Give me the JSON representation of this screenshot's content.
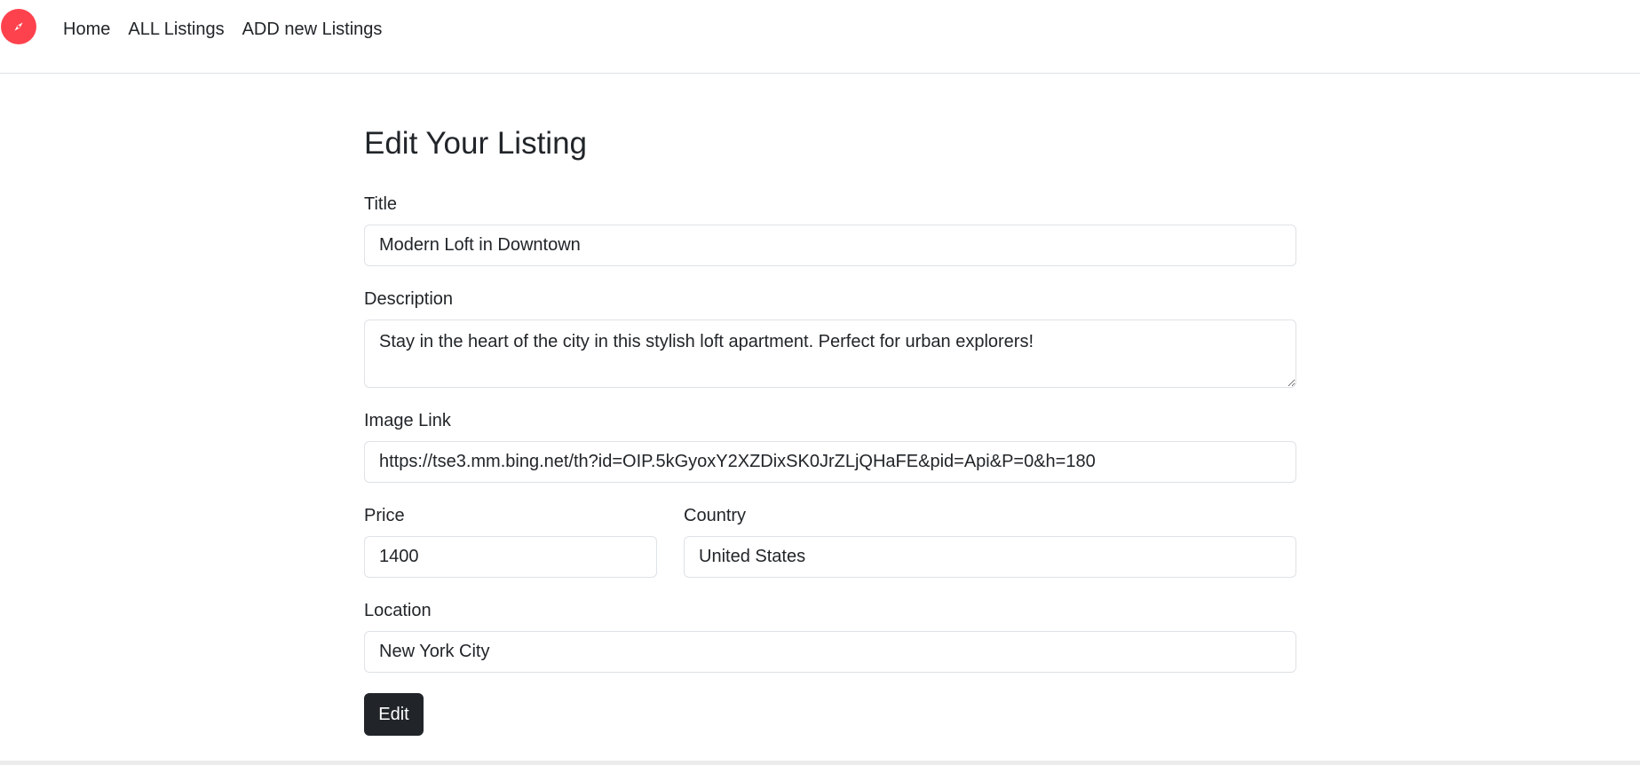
{
  "navbar": {
    "logo_icon": "compass-icon",
    "brand_color": "#fe424d",
    "links": [
      {
        "label": "Home"
      },
      {
        "label": "ALL Listings"
      },
      {
        "label": "ADD new Listings"
      }
    ]
  },
  "form": {
    "heading": "Edit Your Listing",
    "title": {
      "label": "Title",
      "value": "Modern Loft in Downtown"
    },
    "description": {
      "label": "Description",
      "value": "Stay in the heart of the city in this stylish loft apartment. Perfect for urban explorers!"
    },
    "image": {
      "label": "Image Link",
      "value": "https://tse3.mm.bing.net/th?id=OIP.5kGyoxY2XZDixSK0JrZLjQHaFE&pid=Api&P=0&h=180"
    },
    "price": {
      "label": "Price",
      "value": "1400"
    },
    "country": {
      "label": "Country",
      "value": "United States"
    },
    "location": {
      "label": "Location",
      "value": "New York City"
    },
    "submit_label": "Edit"
  }
}
